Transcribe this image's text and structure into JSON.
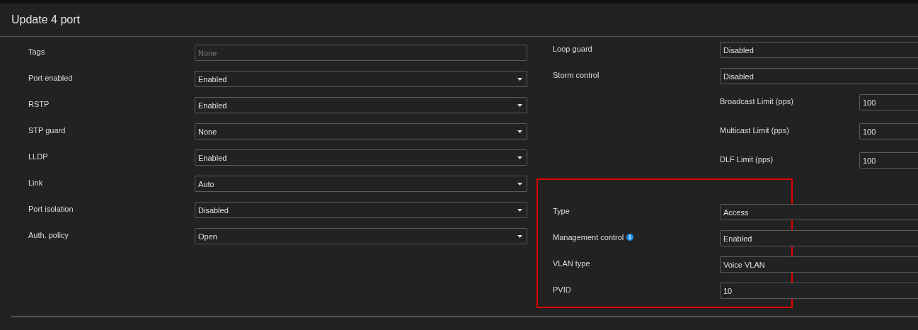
{
  "title": "Update 4 port",
  "left_rows": [
    {
      "label": "Tags",
      "kind": "text",
      "placeholder": "None"
    },
    {
      "label": "Port enabled",
      "kind": "select",
      "value": "Enabled"
    },
    {
      "label": "RSTP",
      "kind": "select",
      "value": "Enabled"
    },
    {
      "label": "STP guard",
      "kind": "select",
      "value": "None"
    },
    {
      "label": "LLDP",
      "kind": "select",
      "value": "Enabled"
    },
    {
      "label": "Link",
      "kind": "select",
      "value": "Auto"
    },
    {
      "label": "Port isolation",
      "kind": "select",
      "value": "Disabled"
    },
    {
      "label": "Auth. policy",
      "kind": "select",
      "value": "Open"
    }
  ],
  "right_rows": [
    {
      "label": "Loop guard",
      "value": "Disabled"
    },
    {
      "label": "Storm control",
      "value": "Disabled"
    }
  ],
  "storm_limits": [
    {
      "label": "Broadcast Limit (pps)",
      "value": "100"
    },
    {
      "label": "Multicast Limit (pps)",
      "value": "100"
    },
    {
      "label": "DLF Limit (pps)",
      "value": "100"
    }
  ],
  "vlan_section": {
    "highlighted": true,
    "rows": [
      {
        "label": "Type",
        "value": "Access",
        "info": false
      },
      {
        "label": "Management control",
        "value": "Enabled",
        "info": true
      },
      {
        "label": "VLAN type",
        "value": "Voice VLAN",
        "info": false
      },
      {
        "label": "PVID",
        "value": "10",
        "info": false
      }
    ]
  }
}
